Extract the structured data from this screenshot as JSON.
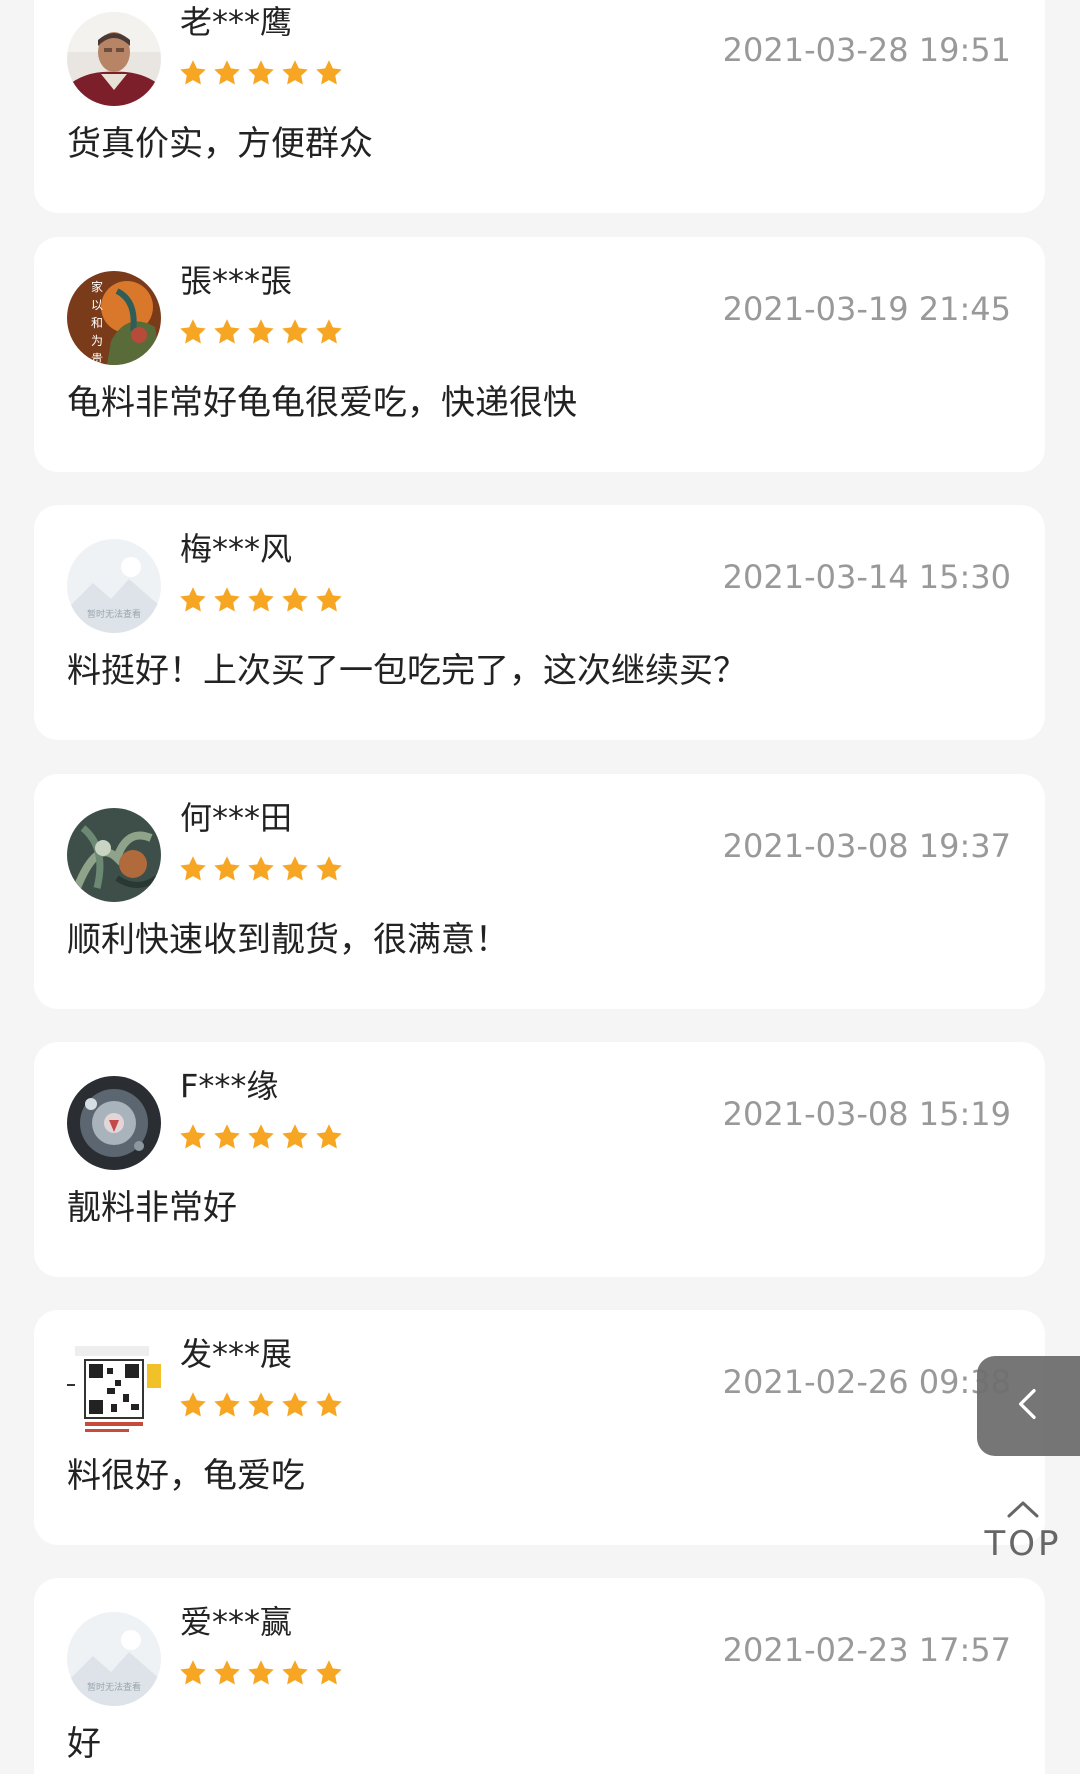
{
  "reviews": [
    {
      "username": "老***鹰",
      "rating": 5,
      "timestamp": "2021-03-28 19:51",
      "comment": "货真价实，方便群众",
      "avatar": "person-photo"
    },
    {
      "username": "張***張",
      "rating": 5,
      "timestamp": "2021-03-19 21:45",
      "comment": "龟料非常好龟龟很爱吃，快递很快",
      "avatar": "painting-with-calligraphy"
    },
    {
      "username": "梅***风",
      "rating": 5,
      "timestamp": "2021-03-14 15:30",
      "comment": "料挺好！上次买了一包吃完了，这次继续买？",
      "avatar": "placeholder-image"
    },
    {
      "username": "何***田",
      "rating": 5,
      "timestamp": "2021-03-08 19:37",
      "comment": "顺利快速收到靓货，很满意！",
      "avatar": "plant-photo"
    },
    {
      "username": "F***缘",
      "rating": 5,
      "timestamp": "2021-03-08 15:19",
      "comment": "靓料非常好",
      "avatar": "glass-sphere-photo"
    },
    {
      "username": "发***展",
      "rating": 5,
      "timestamp": "2021-02-26 09:38",
      "comment": "料很好，龟爱吃",
      "avatar": "qr-code-card"
    },
    {
      "username": "爱***赢",
      "rating": 5,
      "timestamp": "2021-02-23 17:57",
      "comment": "好",
      "avatar": "placeholder-image"
    }
  ],
  "placeholder_avatar_text": "暂时无法查看",
  "calligraphy_text": "家以和为贵",
  "side_tab_icon": "chevron-left-icon",
  "top_button": {
    "label": "TOP",
    "icon": "chevron-up-icon"
  },
  "colors": {
    "star": "#f6a623",
    "timestamp": "#999999",
    "card_bg": "#ffffff",
    "page_bg": "#f5f5f5",
    "side_tab_bg": "#6f6f6f"
  }
}
